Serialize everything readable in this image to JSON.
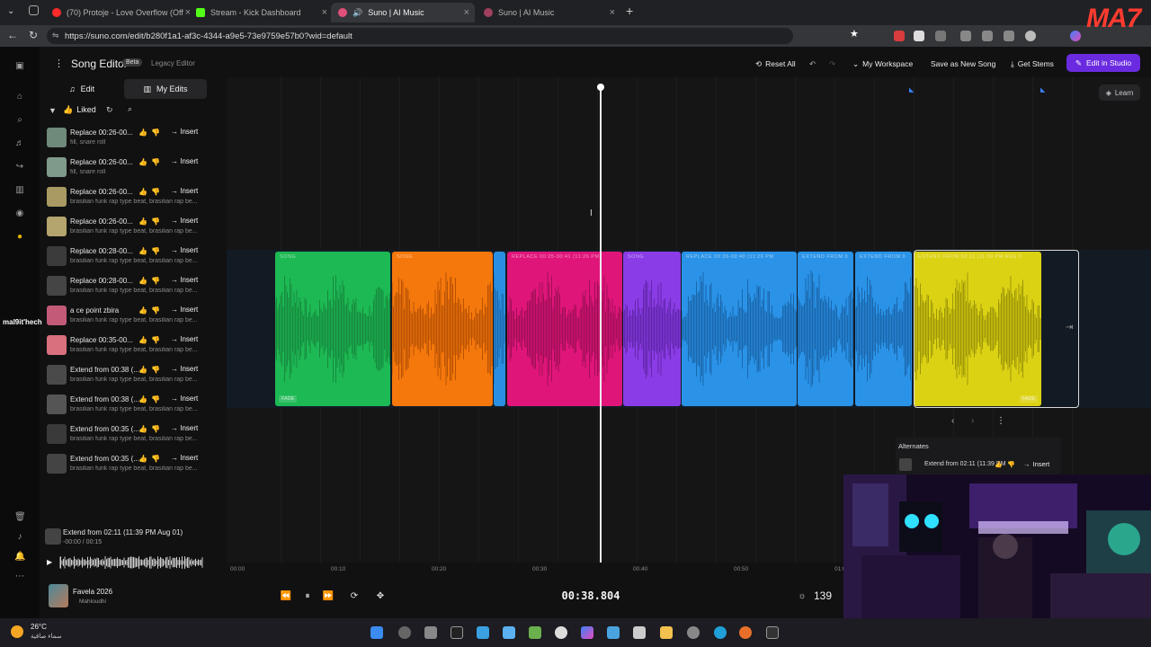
{
  "browser": {
    "tabs": [
      {
        "title": "(70) Protoje - Love Overflow (Offic",
        "color": "#ff2a2a"
      },
      {
        "title": "Stream - Kick Dashboard",
        "color": "#53fc18"
      },
      {
        "title": "Suno | AI Music",
        "color": "#e0507a"
      },
      {
        "title": "Suno | AI Music",
        "color": "#e0507a"
      }
    ],
    "url": "https://suno.com/edit/b280f1a1-af3c-4344-a9e5-73e9759e57b0?wid=default"
  },
  "editor": {
    "title": "Song Editor",
    "badge": "Beta",
    "legacy": "Legacy Editor",
    "seg_edit": "Edit",
    "seg_my_edits": "My Edits",
    "filter_liked": "Liked"
  },
  "toolbar": {
    "reset_all": "Reset All",
    "my_workspace": "My Workspace",
    "save_new_song": "Save as New Song",
    "get_stems": "Get Stems",
    "edit_in_studio": "Edit in Studio",
    "learn": "Learn"
  },
  "edits": [
    {
      "title": "Replace 00:26-00...",
      "sub": "fill, snare roll",
      "thumb": "#6f8a7a"
    },
    {
      "title": "Replace 00:26-00...",
      "sub": "fill, snare roll",
      "thumb": "#7f9a8a"
    },
    {
      "title": "Replace 00:26-00...",
      "sub": "brasilian funk rap type beat, brasilian rap be...",
      "thumb": "#a89a62"
    },
    {
      "title": "Replace 00:26-00...",
      "sub": "brasilian funk rap type beat, brasilian rap be...",
      "thumb": "#b4a46d"
    },
    {
      "title": "Replace 00:28-00...",
      "sub": "brasilian funk rap type beat, brasilian rap be...",
      "thumb": "#3b3b3b"
    },
    {
      "title": "Replace 00:28-00...",
      "sub": "brasilian funk rap type beat, brasilian rap be...",
      "thumb": "#454545"
    },
    {
      "title": "a ce point zbira",
      "sub": "brasilian funk rap type beat, brasilian rap be...",
      "thumb": "#c25a78"
    },
    {
      "title": "Replace 00:35-00...",
      "sub": "brasilian funk rap type beat, brasilian rap be...",
      "thumb": "#d8707e"
    },
    {
      "title": "Extend from 00:38 (...",
      "sub": "brasilian funk rap type beat, brasilian rap be...",
      "thumb": "#4a4a4a"
    },
    {
      "title": "Extend from 00:38 (...",
      "sub": "brasilian funk rap type beat, brasilian rap be...",
      "thumb": "#555"
    },
    {
      "title": "Extend from 00:35 (...",
      "sub": "brasilian funk rap type beat, brasilian rap be...",
      "thumb": "#3a3a3a"
    },
    {
      "title": "Extend from 00:35 (...",
      "sub": "brasilian funk rap type beat, brasilian rap be...",
      "thumb": "#444"
    }
  ],
  "insert_label": "Insert",
  "now_playing": {
    "title": "Extend from 02:11 (11:39 PM Aug 01)",
    "time": "-00:00 / 00:15"
  },
  "song": {
    "title": "Favela 2026",
    "artist": "Mahloudhi"
  },
  "clips": [
    {
      "label": "SONG",
      "color": "#1db954",
      "wave": "#178a3e",
      "fade": "FADE"
    },
    {
      "label": "SONG",
      "color": "#f5780c",
      "wave": "#b85205",
      "fade": ""
    },
    {
      "label": "",
      "color": "#2a8fe0",
      "wave": "#1c6aae",
      "fade": ""
    },
    {
      "label": "REPLACE 00:25-00:41 (11:26 PM",
      "color": "#e0157a",
      "wave": "#a10e57",
      "fade": ""
    },
    {
      "label": "SONG",
      "color": "#8a3ce6",
      "wave": "#6226aa",
      "fade": ""
    },
    {
      "label": "REPLACE 00:26-00:40 (11:26 PM",
      "color": "#2a93e8",
      "wave": "#1a66aa",
      "fade": ""
    },
    {
      "label": "EXTEND FROM 0",
      "color": "#2a93e8",
      "wave": "#1a66aa",
      "fade": ""
    },
    {
      "label": "EXTEND FROM 0",
      "color": "#2a93e8",
      "wave": "#1a66aa",
      "fade": ""
    },
    {
      "label": "EXTEND FROM 02:11 (11:39 PM AUG 0",
      "color": "#dcd214",
      "wave": "#9c9608",
      "fade": "FADE"
    }
  ],
  "ticks": [
    "00:00",
    "00:10",
    "00:20",
    "00:30",
    "00:40",
    "00:50",
    "01:00"
  ],
  "transport": {
    "time": "00:38.804",
    "bpm": "139"
  },
  "alternates": {
    "title": "Alternates",
    "item": "Extend from 02:11 (11:39 PM",
    "insert": "Insert"
  },
  "overlay": {
    "chat_user": "mal9it'hech",
    "logo": "MA7"
  },
  "taskbar": {
    "temp": "26°C",
    "weather": "سماء صافية"
  }
}
